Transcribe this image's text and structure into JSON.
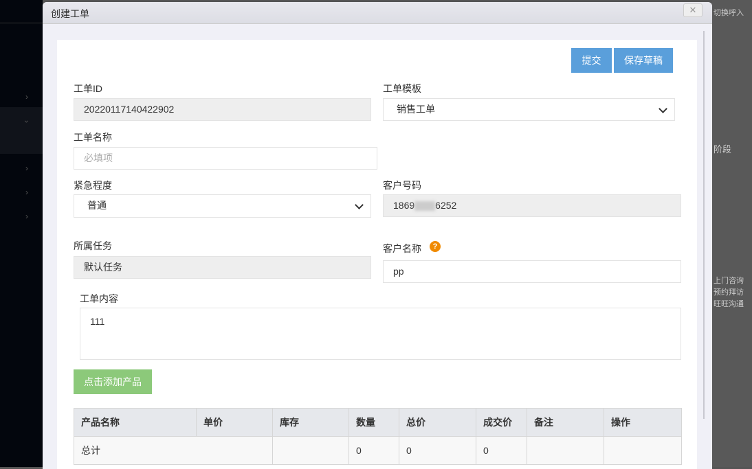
{
  "background": {
    "right_texts": [
      "切换呼入",
      "阶段",
      "上门咨询",
      "预约拜访",
      "旺旺沟通"
    ]
  },
  "modal": {
    "title": "创建工单",
    "close": "✕"
  },
  "toolbar": {
    "submit": "提交",
    "save_draft": "保存草稿"
  },
  "form": {
    "id_label": "工单ID",
    "id_value": "20220117140422902",
    "template_label": "工单模板",
    "template_value": "销售工单",
    "name_label": "工单名称",
    "name_placeholder": "必填项",
    "urgency_label": "紧急程度",
    "urgency_value": "普通",
    "phone_label": "客户号码",
    "phone_prefix": "1869",
    "phone_suffix": "6252",
    "task_label": "所属任务",
    "task_value": "默认任务",
    "customer_label": "客户名称",
    "customer_help": "?",
    "customer_value": "pp",
    "content_label": "工单内容",
    "content_value": "111",
    "add_product": "点击添加产品"
  },
  "table": {
    "headers": [
      "产品名称",
      "单价",
      "库存",
      "数量",
      "总价",
      "成交价",
      "备注",
      "操作"
    ],
    "total_row": {
      "label": "总计",
      "quantity": "0",
      "total": "0",
      "deal": "0"
    }
  },
  "colors": {
    "primary": "#5a9fdb",
    "success": "#8cc97a",
    "help": "#f08a00"
  }
}
